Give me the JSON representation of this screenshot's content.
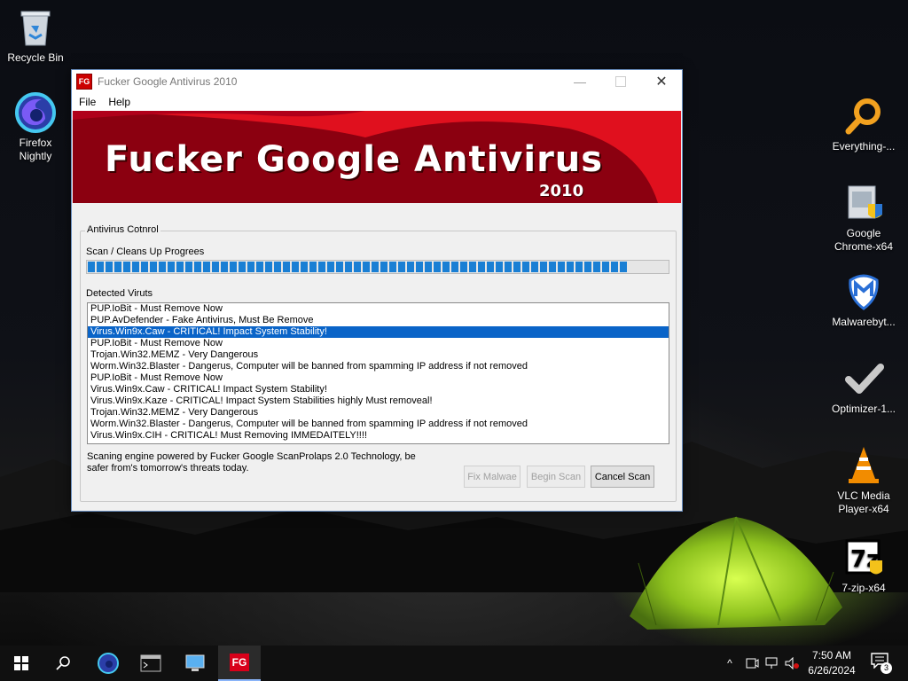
{
  "desktop": {
    "icons_left": [
      {
        "label_lines": [
          "Recycle Bin"
        ],
        "icon": "recycle-bin-icon"
      },
      {
        "label_lines": [
          "Firefox",
          "Nightly"
        ],
        "icon": "firefox-nightly-icon"
      }
    ],
    "icons_right": [
      {
        "label_lines": [
          "Everything-..."
        ],
        "icon": "everything-search-icon"
      },
      {
        "label_lines": [
          "Google",
          "Chrome-x64"
        ],
        "icon": "chrome-installer-icon"
      },
      {
        "label_lines": [
          "Malwarebyt..."
        ],
        "icon": "malwarebytes-icon"
      },
      {
        "label_lines": [
          "Optimizer-1..."
        ],
        "icon": "optimizer-checkmark-icon"
      },
      {
        "label_lines": [
          "VLC Media",
          "Player-x64"
        ],
        "icon": "vlc-cone-icon"
      },
      {
        "label_lines": [
          "7-zip-x64"
        ],
        "icon": "7zip-icon"
      }
    ]
  },
  "window": {
    "app_icon_text": "FG",
    "title": "Fucker Google Antivirus 2010",
    "menu": [
      "File",
      "Help"
    ],
    "banner_title": "Fucker Google Antivirus",
    "banner_year": "2010",
    "group_label": "Antivirus Cotnrol",
    "progress_label": "Scan / Cleans Up Progrees",
    "progress_fraction": 0.94,
    "detected_label": "Detected Viruts",
    "detections": [
      "PUP.IoBit - Must Remove Now",
      "PUP.AvDefender - Fake Antivirus, Must Be Remove",
      "Virus.Win9x.Caw - CRITICAL! Impact System Stability!",
      "PUP.IoBit - Must Remove Now",
      "Trojan.Win32.MEMZ - Very Dangerous",
      "Worm.Win32.Blaster - Dangerus, Computer will be banned from spamming IP address if not removed",
      "PUP.IoBit - Must Remove Now",
      "Virus.Win9x.Caw - CRITICAL! Impact System Stability!",
      "Virus.Win9x.Kaze - CRITICAL! Impact System Stabilities highly Must removeal!",
      "Trojan.Win32.MEMZ - Very Dangerous",
      "Worm.Win32.Blaster - Dangerus, Computer will be banned from spamming IP address if not removed",
      "Virus.Win9x.CIH - CRITICAL! Must Removing IMMEDAITELY!!!!"
    ],
    "selected_index": 2,
    "footer_line1": "Scaning engine powered by Fucker Google ScanProlaps 2.0 Technology, be",
    "footer_line2": "safer from's tomorrow's threats today.",
    "buttons": {
      "fix": "Fix Malwae",
      "begin": "Begin Scan",
      "cancel": "Cancel Scan"
    }
  },
  "taskbar": {
    "time": "7:50 AM",
    "date": "6/26/2024",
    "notification_count": "3",
    "fg_label": "FG"
  }
}
